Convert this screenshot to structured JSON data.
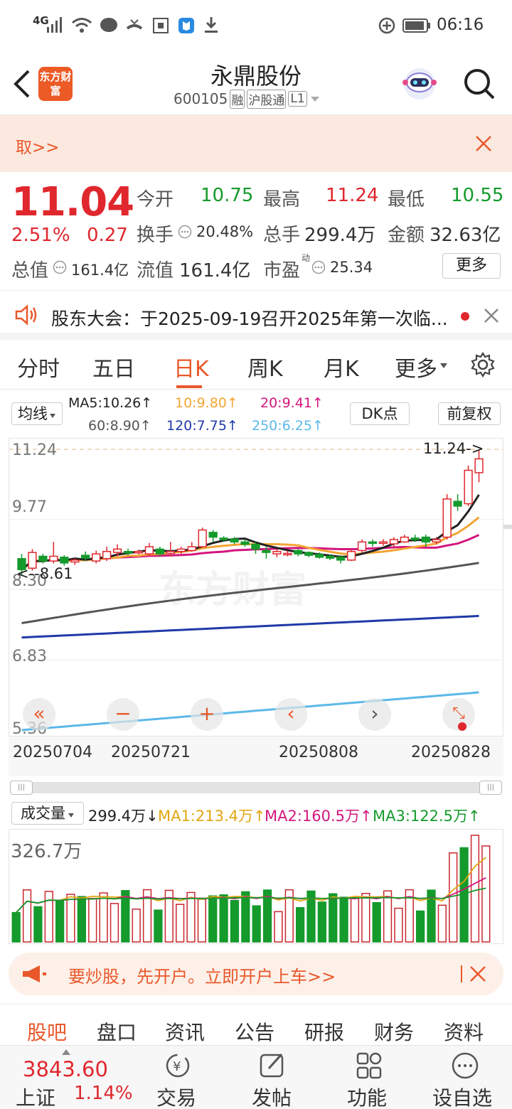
{
  "status_bar": {
    "network": "4G",
    "time": "06:16"
  },
  "header": {
    "stock_name": "永鼎股份",
    "stock_code": "600105",
    "badges": [
      "融",
      "沪股通",
      "L1"
    ],
    "app_logo": "东方财富"
  },
  "banner": {
    "text": "取>>"
  },
  "quote": {
    "price": "11.04",
    "change_pct": "2.51%",
    "change": "0.27",
    "open_label": "今开",
    "open": "10.75",
    "high_label": "最高",
    "high": "11.24",
    "low_label": "最低",
    "low": "10.55",
    "turnover_label": "换手",
    "turnover": "20.48%",
    "volume_label": "总手",
    "volume": "299.4万",
    "amount_label": "金额",
    "amount": "32.63亿",
    "total_cap_label": "总值",
    "total_cap": "161.4亿",
    "float_cap_label": "流值",
    "float_cap": "161.4亿",
    "pe_label": "市盈",
    "pe_sup": "动",
    "pe": "25.34",
    "more_label": "更多"
  },
  "notice": {
    "text": "股东大会：于2025-09-19召开2025年第一次临..."
  },
  "tabs": [
    "分时",
    "五日",
    "日K",
    "周K",
    "月K",
    "更多"
  ],
  "chart": {
    "indicator_label": "均线",
    "ma_items": [
      {
        "label": "MA5:10.26↑",
        "color": "#222222"
      },
      {
        "label": "10:9.80↑",
        "color": "#f3a533"
      },
      {
        "label": "20:9.41↑",
        "color": "#d3167e"
      },
      {
        "label": "60:8.90↑",
        "color": "#555555"
      },
      {
        "label": "120:7.75↑",
        "color": "#1f3aa8"
      },
      {
        "label": "250:6.25↑",
        "color": "#5cb8e8"
      }
    ],
    "dk_label": "DK点",
    "adjust_label": "前复权",
    "y_labels": [
      "11.24",
      "9.77",
      "8.30",
      "6.83",
      "5.36"
    ],
    "high_marker": "11.24->",
    "low_marker": "<--8.61",
    "dates": [
      "20250704",
      "20250721",
      "20250808",
      "20250828"
    ],
    "watermark": "东方财富"
  },
  "volume": {
    "label": "成交量",
    "current": "299.4万↓",
    "ma1": "MA1:213.4万↑",
    "ma2": "MA2:160.5万↑",
    "ma3": "MA3:122.5万↑",
    "max_label": "326.7万"
  },
  "ad": {
    "text": "要炒股，先开户。立即开户上车>>"
  },
  "bottom_tabs": [
    "股吧",
    "盘口",
    "资讯",
    "公告",
    "研报",
    "财务",
    "资料"
  ],
  "footer": {
    "index_value": "3843.60",
    "index_name": "上证",
    "index_change": "1.14%",
    "items": [
      "交易",
      "发帖",
      "功能",
      "设自选"
    ]
  },
  "chart_data": {
    "type": "candlestick",
    "ylim": [
      5.36,
      11.24
    ],
    "candles": [
      {
        "o": 8.95,
        "c": 8.72,
        "h": 9.05,
        "l": 8.61
      },
      {
        "o": 8.75,
        "c": 9.08,
        "h": 9.15,
        "l": 8.7
      },
      {
        "o": 9.0,
        "c": 8.9,
        "h": 9.05,
        "l": 8.85
      },
      {
        "o": 8.9,
        "c": 9.0,
        "h": 9.3,
        "l": 8.85
      },
      {
        "o": 8.98,
        "c": 8.86,
        "h": 9.02,
        "l": 8.8
      },
      {
        "o": 8.88,
        "c": 8.92,
        "h": 8.96,
        "l": 8.82
      },
      {
        "o": 9.02,
        "c": 8.96,
        "h": 9.1,
        "l": 8.9
      },
      {
        "o": 8.9,
        "c": 9.05,
        "h": 9.12,
        "l": 8.85
      },
      {
        "o": 8.95,
        "c": 9.1,
        "h": 9.2,
        "l": 8.9
      },
      {
        "o": 9.08,
        "c": 9.15,
        "h": 9.25,
        "l": 9.0
      },
      {
        "o": 9.1,
        "c": 9.08,
        "h": 9.16,
        "l": 9.02
      },
      {
        "o": 9.08,
        "c": 9.1,
        "h": 9.14,
        "l": 9.04
      },
      {
        "o": 9.05,
        "c": 9.2,
        "h": 9.28,
        "l": 9.0
      },
      {
        "o": 9.15,
        "c": 9.05,
        "h": 9.2,
        "l": 9.0
      },
      {
        "o": 9.06,
        "c": 9.1,
        "h": 9.3,
        "l": 9.0
      },
      {
        "o": 9.1,
        "c": 9.15,
        "h": 9.2,
        "l": 9.05
      },
      {
        "o": 9.12,
        "c": 9.2,
        "h": 9.3,
        "l": 9.1
      },
      {
        "o": 9.2,
        "c": 9.55,
        "h": 9.6,
        "l": 9.18
      },
      {
        "o": 9.5,
        "c": 9.4,
        "h": 9.55,
        "l": 9.3
      },
      {
        "o": 9.38,
        "c": 9.35,
        "h": 9.42,
        "l": 9.3
      },
      {
        "o": 9.36,
        "c": 9.3,
        "h": 9.4,
        "l": 9.25
      },
      {
        "o": 9.3,
        "c": 9.25,
        "h": 9.35,
        "l": 9.2
      },
      {
        "o": 9.25,
        "c": 9.15,
        "h": 9.3,
        "l": 9.05
      },
      {
        "o": 9.12,
        "c": 9.08,
        "h": 9.2,
        "l": 8.95
      },
      {
        "o": 9.05,
        "c": 9.1,
        "h": 9.15,
        "l": 8.98
      },
      {
        "o": 9.05,
        "c": 9.06,
        "h": 9.12,
        "l": 9.0
      },
      {
        "o": 9.12,
        "c": 9.05,
        "h": 9.15,
        "l": 9.0
      },
      {
        "o": 9.08,
        "c": 9.02,
        "h": 9.1,
        "l": 8.98
      },
      {
        "o": 9.04,
        "c": 8.98,
        "h": 9.08,
        "l": 8.95
      },
      {
        "o": 9.0,
        "c": 8.96,
        "h": 9.04,
        "l": 8.92
      },
      {
        "o": 8.98,
        "c": 8.92,
        "h": 9.02,
        "l": 8.85
      },
      {
        "o": 8.92,
        "c": 9.1,
        "h": 9.15,
        "l": 8.9
      },
      {
        "o": 9.12,
        "c": 9.3,
        "h": 9.35,
        "l": 9.08
      },
      {
        "o": 9.3,
        "c": 9.28,
        "h": 9.35,
        "l": 9.2
      },
      {
        "o": 9.28,
        "c": 9.3,
        "h": 9.36,
        "l": 9.22
      },
      {
        "o": 9.26,
        "c": 9.35,
        "h": 9.4,
        "l": 9.2
      },
      {
        "o": 9.3,
        "c": 9.4,
        "h": 9.45,
        "l": 9.28
      },
      {
        "o": 9.38,
        "c": 9.36,
        "h": 9.45,
        "l": 9.3
      },
      {
        "o": 9.4,
        "c": 9.3,
        "h": 9.45,
        "l": 9.2
      },
      {
        "o": 9.3,
        "c": 9.35,
        "h": 9.4,
        "l": 9.25
      },
      {
        "o": 9.4,
        "c": 10.2,
        "h": 10.3,
        "l": 9.35
      },
      {
        "o": 10.15,
        "c": 10.05,
        "h": 10.3,
        "l": 9.95
      },
      {
        "o": 10.1,
        "c": 10.8,
        "h": 10.9,
        "l": 10.05
      },
      {
        "o": 10.75,
        "c": 11.04,
        "h": 11.24,
        "l": 10.55
      }
    ],
    "volume_max": 326.7
  }
}
